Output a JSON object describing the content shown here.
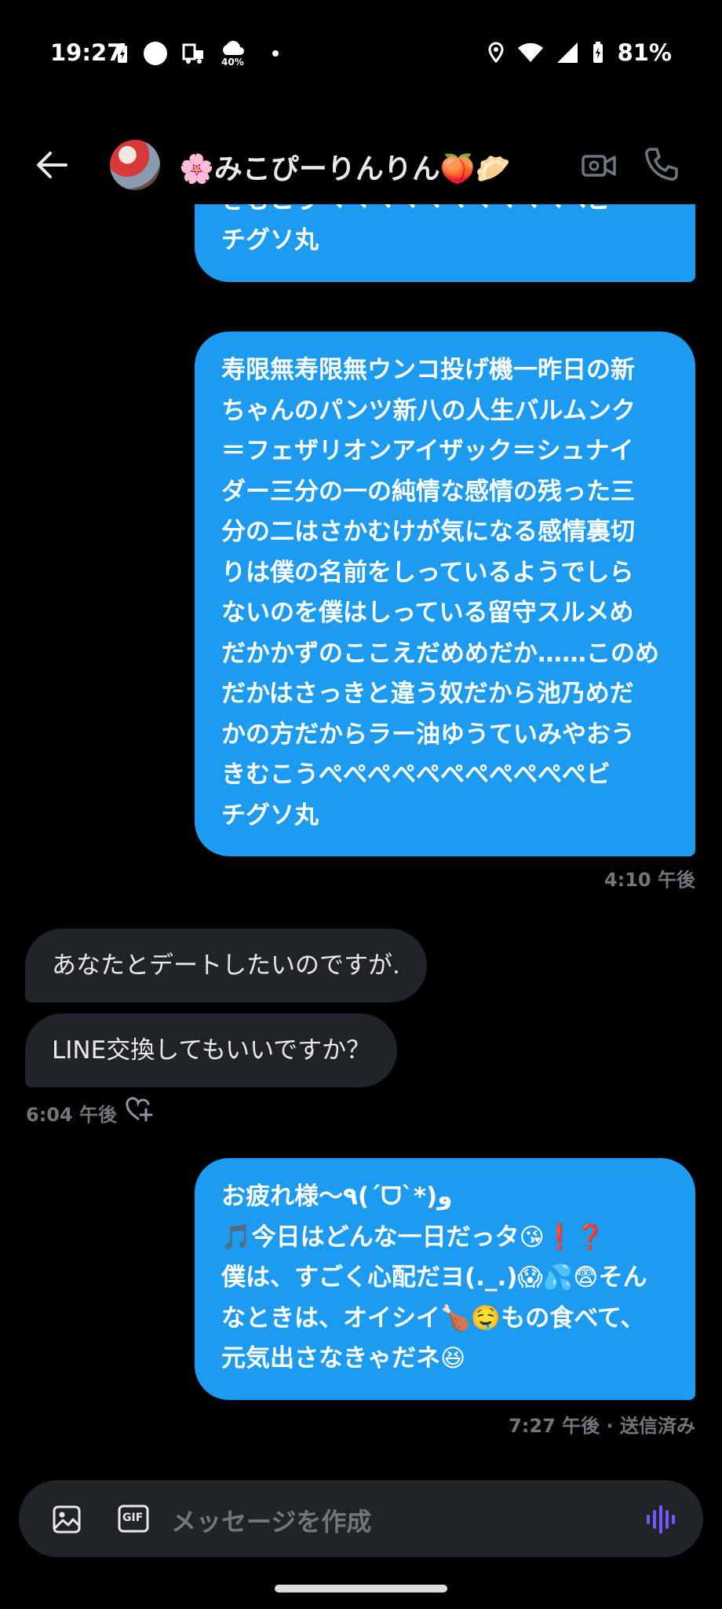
{
  "status_bar": {
    "time": "19:27",
    "weather_percent": "40%",
    "battery": "81%",
    "icons": [
      "battery-charging-icon",
      "circle-icon",
      "shopping-icon",
      "weather-icon",
      "dot-icon",
      "location-icon",
      "wifi-icon",
      "signal-icon",
      "battery-icon"
    ]
  },
  "header": {
    "title": "🌸みこぴーりんりん🍑🥟",
    "icons": [
      "back-arrow-icon",
      "video-call-icon",
      "phone-icon"
    ]
  },
  "messages": [
    {
      "direction": "out",
      "text": "かの方だからラー油ゆうていみやおう\nきむこうぺぺぺぺぺぺぺぺぺぺぺビ\nチグソ丸"
    },
    {
      "direction": "out",
      "text": "寿限無寿限無ウンコ投げ機一昨日の新\nちゃんのパンツ新八の人生バルムンク\n＝フェザリオンアイザック＝シュナイ\nダー三分の一の純情な感情の残った三\n分の二はさかむけが気になる感情裏切\nりは僕の名前をしっているようでしら\nないのを僕はしっている留守スルメめ\nだかかずのここえだめめだか……このめ\nだかはさっきと違う奴だから池乃めだ\nかの方だからラー油ゆうていみやおう\nきむこうぺぺぺぺぺぺぺぺぺぺぺビ\nチグソ丸",
      "time": "4:10 午後"
    },
    {
      "direction": "in",
      "text": "あなたとデートしたいのですが."
    },
    {
      "direction": "in",
      "text": "LINE交換してもいいですか？",
      "time": "6:04 午後"
    },
    {
      "direction": "out",
      "text": "お疲れ様〜٩(ˊᗜˋ*)و\n🎵今日はどんな一日だっタ😘❗❓\n僕は、すごく心配だヨ(._.)😱💦😨そん\nなときは、オイシイ🍗🤤もの食べて、\n元気出さなきゃだネ😆",
      "time": "7:27 午後 · 送信済み"
    }
  ],
  "composer": {
    "placeholder": "メッセージを作成",
    "gif_label": "GIF"
  },
  "colors": {
    "accent": "#1d9bf0",
    "incoming_bubble": "#202327",
    "muted_text": "#71767b",
    "voice_icon": "#7856ff"
  }
}
